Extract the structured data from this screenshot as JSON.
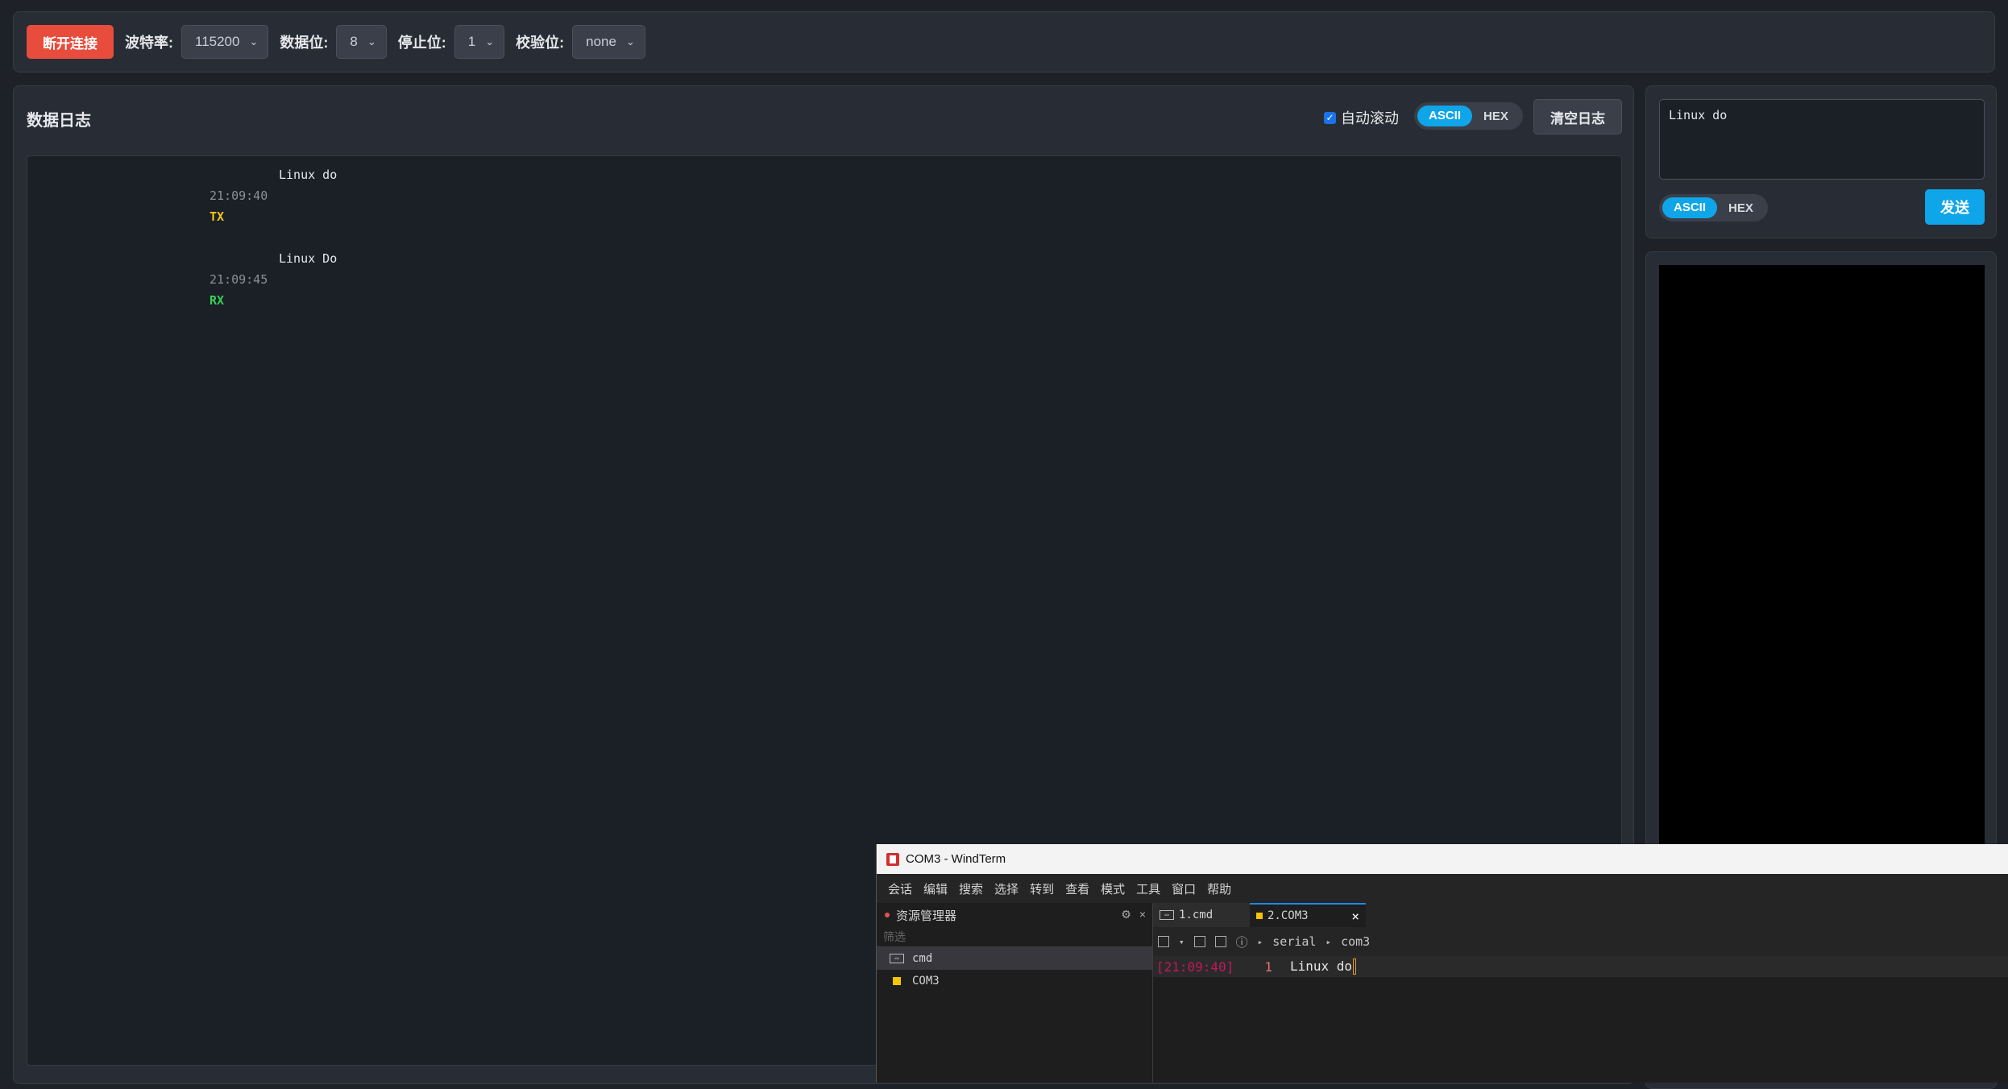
{
  "toolbar": {
    "disconnect": "断开连接",
    "baud_label": "波特率:",
    "baud_value": "115200",
    "databits_label": "数据位:",
    "databits_value": "8",
    "stopbits_label": "停止位:",
    "stopbits_value": "1",
    "parity_label": "校验位:",
    "parity_value": "none"
  },
  "log": {
    "title": "数据日志",
    "autoscroll": "自动滚动",
    "mode_ascii": "ASCII",
    "mode_hex": "HEX",
    "clear": "清空日志",
    "entries": [
      {
        "message": "Linux do",
        "time": "21:09:40",
        "direction": "TX"
      },
      {
        "message": "Linux Do",
        "time": "21:09:45",
        "direction": "RX"
      }
    ]
  },
  "send": {
    "value": "Linux do",
    "mode_ascii": "ASCII",
    "mode_hex": "HEX",
    "button": "发送"
  },
  "colors": {
    "tx": "#f5c518",
    "rx": "#34d058",
    "accent": "#0ea5e9",
    "danger": "#e74c3c"
  },
  "windterm": {
    "title": "COM3 - WindTerm",
    "menu": [
      "会话",
      "编辑",
      "搜索",
      "选择",
      "转到",
      "查看",
      "模式",
      "工具",
      "窗口",
      "帮助"
    ],
    "explorer_title": "资源管理器",
    "filter_placeholder": "筛选",
    "items": [
      "cmd",
      "COM3"
    ],
    "tabs": [
      "1.cmd",
      "2.COM3"
    ],
    "breadcrumb": [
      "serial",
      "com3"
    ],
    "line": {
      "time": "[21:09:40]",
      "num": "1",
      "text": "Linux do"
    }
  }
}
